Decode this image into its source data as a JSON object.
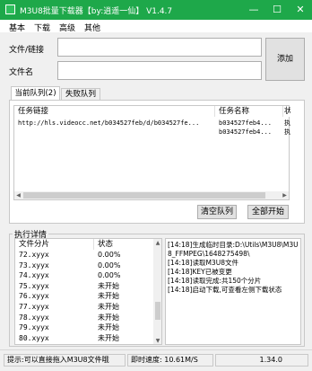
{
  "window": {
    "title": "M3U8批量下载器【by:逍遥一仙】 V1.4.7",
    "min_symbol": "—",
    "max_symbol": "☐",
    "close_symbol": "✕"
  },
  "menu": [
    "基本",
    "下载",
    "高级",
    "其他"
  ],
  "form": {
    "url_label": "文件/链接",
    "url_value": "",
    "name_label": "文件名",
    "name_value": "",
    "add_button": "添加"
  },
  "tabs": [
    "当前队列(2)",
    "失败队列"
  ],
  "queue": {
    "columns": [
      "任务链接",
      "任务名称",
      "状"
    ],
    "rows": [
      {
        "link": "http://hls.videocc.net/b034527feb/d/b034527fe...",
        "name": "b034527feb4...",
        "status": "执"
      },
      {
        "link": "",
        "name": "b034527feb4...",
        "status": "执"
      }
    ]
  },
  "buttons": {
    "clear": "清空队列",
    "start_all": "全部开始"
  },
  "details": {
    "group_label": "执行详情",
    "columns": [
      "文件分片",
      "状态"
    ],
    "rows": [
      {
        "file": "72.xyyx",
        "status": "0.00%"
      },
      {
        "file": "73.xyyx",
        "status": "0.00%"
      },
      {
        "file": "74.xyyx",
        "status": "0.00%"
      },
      {
        "file": "75.xyyx",
        "status": "未开始"
      },
      {
        "file": "76.xyyx",
        "status": "未开始"
      },
      {
        "file": "77.xyyx",
        "status": "未开始"
      },
      {
        "file": "78.xyyx",
        "status": "未开始"
      },
      {
        "file": "79.xyyx",
        "status": "未开始"
      },
      {
        "file": "80.xyyx",
        "status": "未开始"
      }
    ],
    "log": "[14:18]生成临时目录:D:\\Utils\\M3U8\\M3U8_FFMPEG\\1648275498\\\n[14:18]读取M3U8文件\n[14:18]KEY已被变更\n[14:18]读取完成:共150个分片\n[14:18]启动下载,可查看左侧下载状态"
  },
  "status": {
    "tip": "提示:可以直接拖入M3U8文件哦",
    "speed": "即时速度: 10.61M/S",
    "value": "1.34.0"
  }
}
